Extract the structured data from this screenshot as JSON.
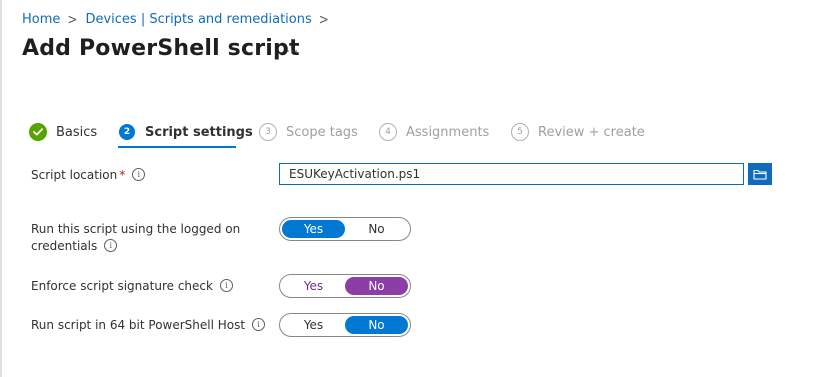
{
  "breadcrumb": {
    "home": "Home",
    "parent": "Devices | Scripts and remediations",
    "separator": ">"
  },
  "page": {
    "title": "Add PowerShell script",
    "more": "..."
  },
  "wizard": {
    "steps": [
      {
        "label": "Basics",
        "state": "done"
      },
      {
        "number": "2",
        "label": "Script settings",
        "state": "current"
      },
      {
        "number": "3",
        "label": "Scope tags",
        "state": "future"
      },
      {
        "number": "4",
        "label": "Assignments",
        "state": "future"
      },
      {
        "number": "5",
        "label": "Review + create",
        "state": "future"
      }
    ]
  },
  "form": {
    "script_location": {
      "label": "Script location",
      "required": "*",
      "value": "ESUKeyActivation.ps1"
    },
    "run_logged_on": {
      "label_line1": "Run this script using the logged on",
      "label_line2": "credentials",
      "yes": "Yes",
      "no": "No",
      "selected": "Yes"
    },
    "signature_check": {
      "label": "Enforce script signature check",
      "yes": "Yes",
      "no": "No",
      "selected": "No"
    },
    "run_64bit": {
      "label": "Run script in 64 bit PowerShell Host",
      "yes": "Yes",
      "no": "No",
      "selected": "No"
    }
  },
  "icons": {
    "info": "info-icon",
    "check": "checkmark-icon",
    "browse": "folder-icon"
  },
  "colors": {
    "link": "#0f6cbd",
    "accent": "#0078d4",
    "success": "#57a300",
    "purple": "#8a3ea6",
    "required": "#a4262c"
  }
}
